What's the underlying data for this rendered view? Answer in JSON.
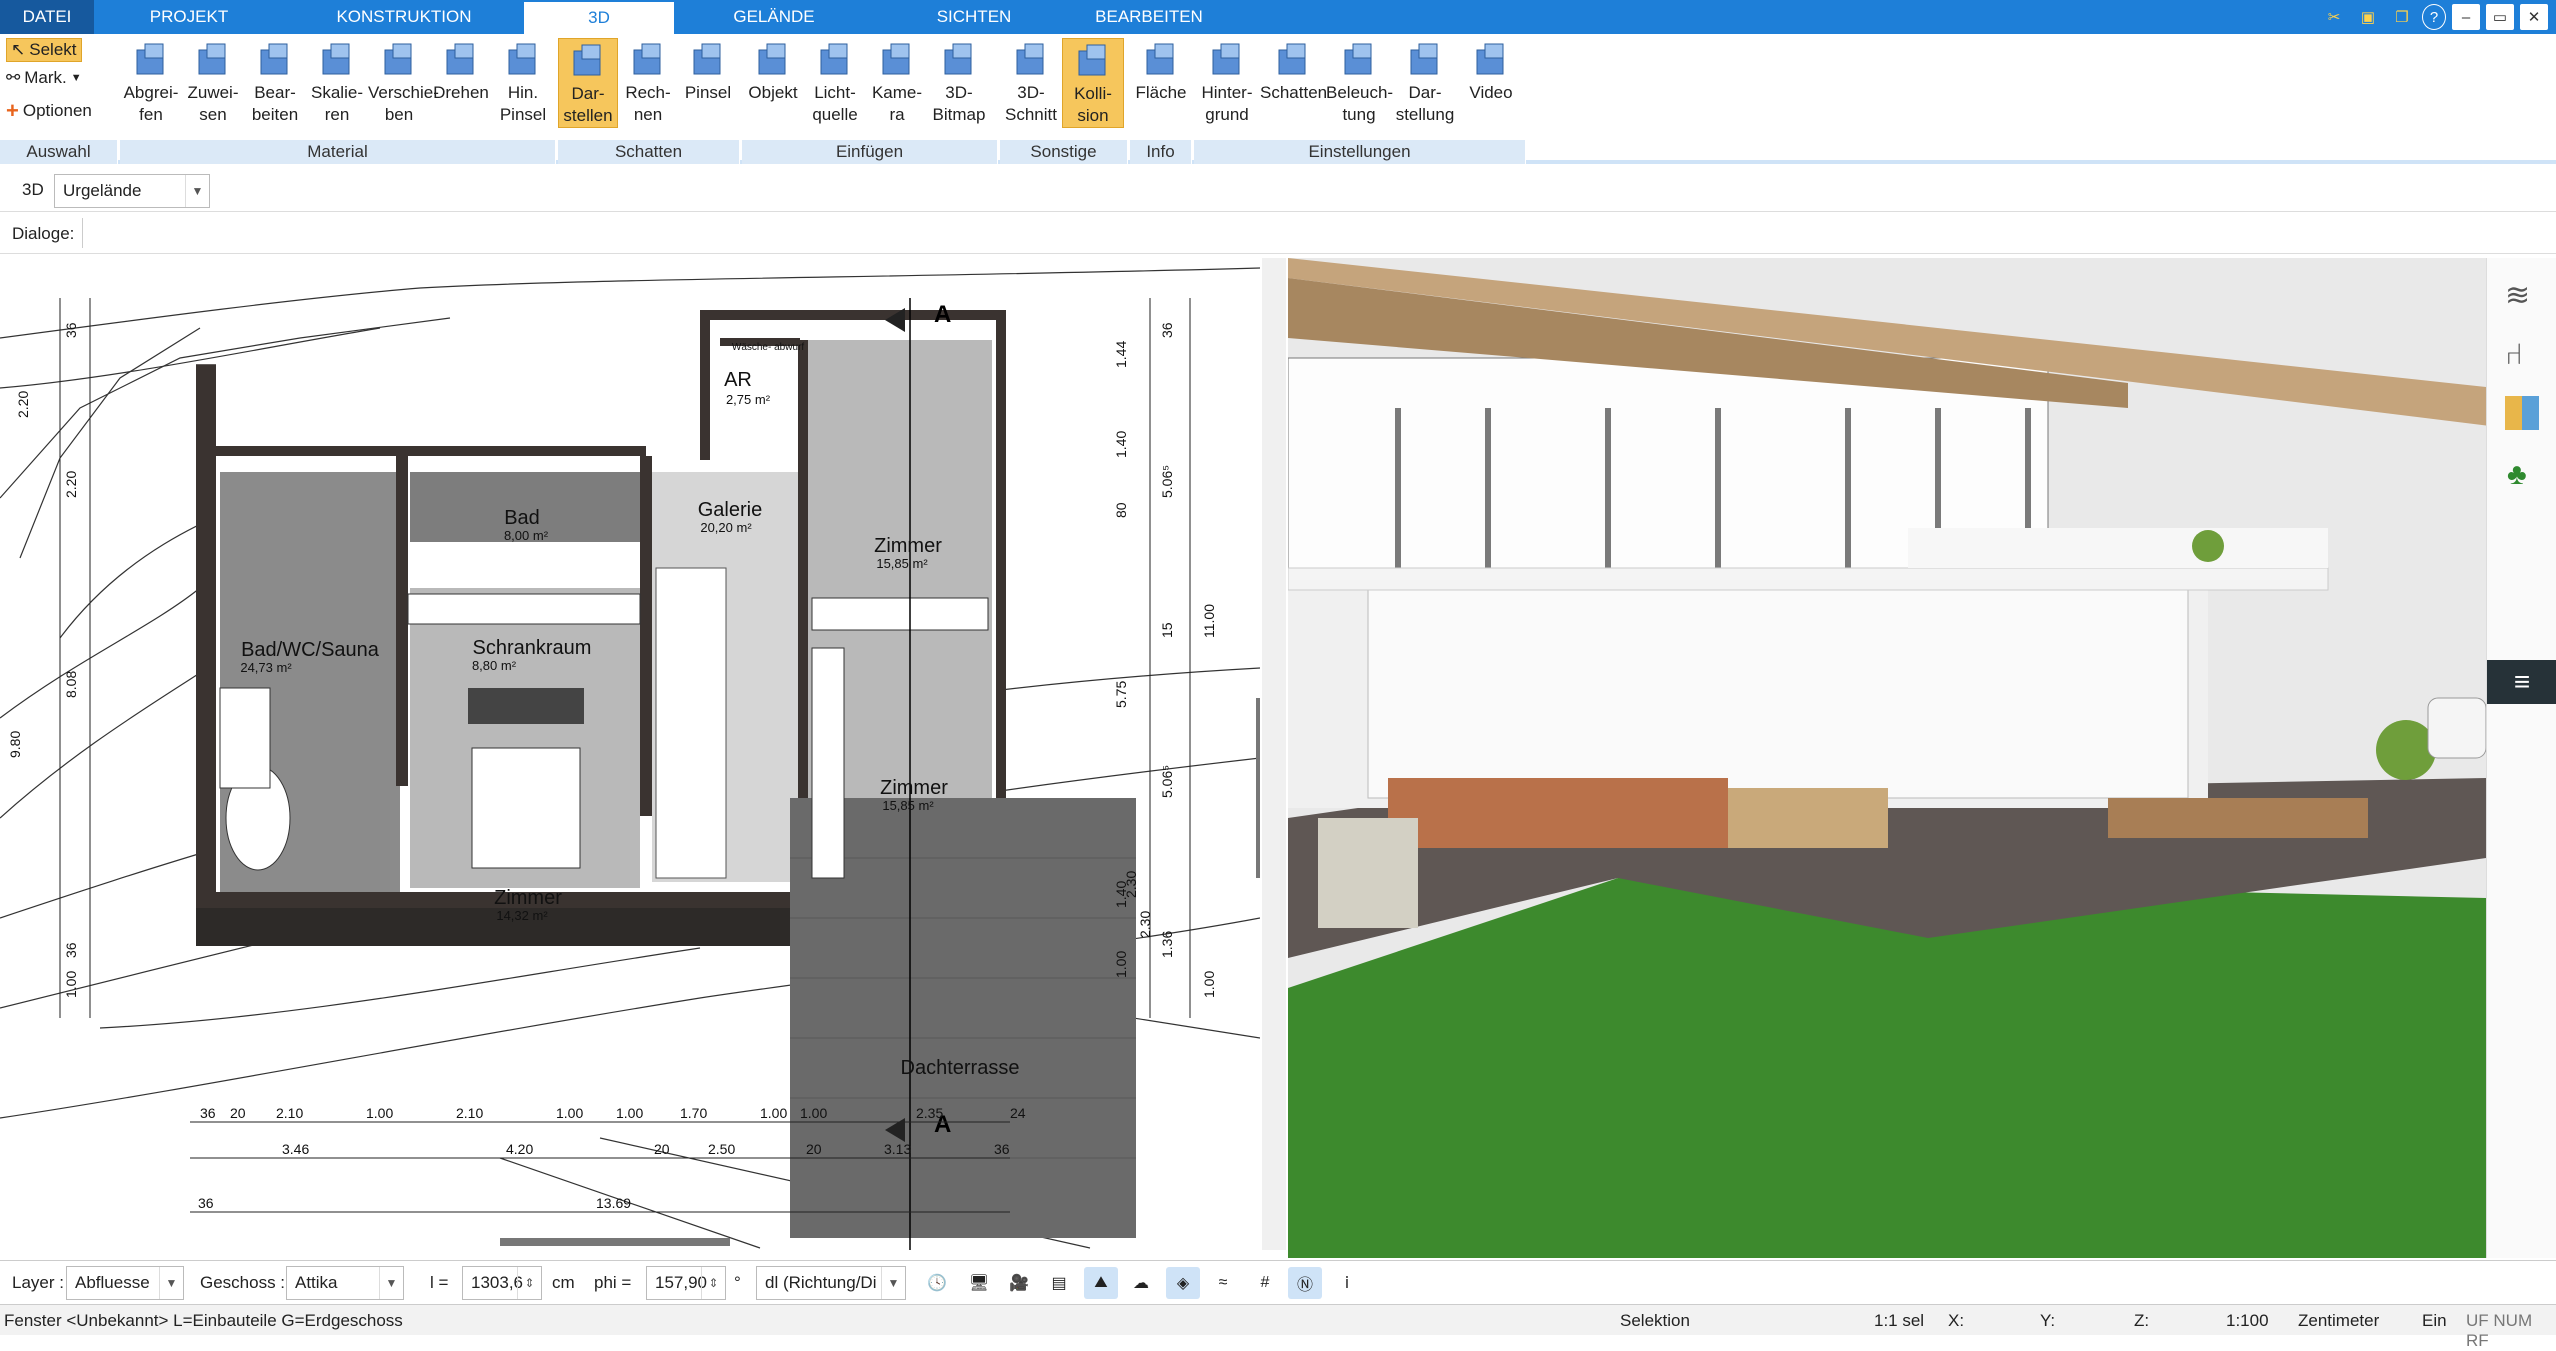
{
  "menu": {
    "file": "DATEI",
    "tabs": [
      "PROJEKT",
      "KONSTRUKTION",
      "3D",
      "GELÄNDE",
      "SICHTEN",
      "BEARBEITEN"
    ],
    "active": "3D"
  },
  "ribbon": {
    "auswahl": {
      "select": "Selekt",
      "mark": "Mark.",
      "options": "Optionen",
      "label": "Auswahl"
    },
    "material": {
      "label": "Material",
      "buttons": [
        "Abgrei-\nfen",
        "Zuwei-\nsen",
        "Bear-\nbeiten",
        "Skalie-\nren",
        "Verschie-\nben",
        "Drehen",
        "Hin.\nPinsel"
      ]
    },
    "schatten": {
      "label": "Schatten",
      "buttons": [
        "Dar-\nstellen",
        "Rech-\nnen",
        "Pinsel"
      ]
    },
    "einfuegen": {
      "label": "Einfügen",
      "buttons": [
        "Objekt",
        "Licht-\nquelle",
        "Kame-\nra",
        "3D-\nBitmap"
      ]
    },
    "sonstige": {
      "label": "Sonstige",
      "buttons": [
        "3D-\nSchnitt",
        "Kolli-\nsion"
      ]
    },
    "info": {
      "label": "Info",
      "buttons": [
        "Fläche"
      ]
    },
    "einstellungen": {
      "label": "Einstellungen",
      "buttons": [
        "Hinter-\ngrund",
        "Schatten",
        "Beleuch-\ntung",
        "Dar-\nstellung",
        "Video"
      ]
    }
  },
  "toolbar": {
    "mode": "3D",
    "terrain": "Urgelände",
    "dialoge": "Dialoge:"
  },
  "plan": {
    "rooms": [
      {
        "name": "AR",
        "area": "2,75 m²"
      },
      {
        "name": "Bad",
        "area": "8,00 m²"
      },
      {
        "name": "Galerie",
        "area": "20,20 m²"
      },
      {
        "name": "Zimmer",
        "area": "15,85 m²"
      },
      {
        "name": "Bad/WC/Sauna",
        "area": "24,73 m²"
      },
      {
        "name": "Schrankraum",
        "area": "8,80 m²"
      },
      {
        "name": "Zimmer",
        "area": "15,85 m²"
      },
      {
        "name": "Zimmer",
        "area": "14,32 m²"
      },
      {
        "name": "Dachterrasse",
        "area": ""
      }
    ],
    "waesche": "Wäsche-\nabwurf",
    "section": "A",
    "dims_bottom1": [
      "36",
      "20",
      "2.10",
      "1.00",
      "2.10",
      "1.00",
      "1.00",
      "1.70",
      "1.00",
      "1.00",
      "2.35",
      "24"
    ],
    "dims_bottom2": [
      "3.46",
      "4.20",
      "20",
      "2.50",
      "20",
      "3.13",
      "36"
    ],
    "dims_bottom3": [
      "36",
      "13.69"
    ],
    "dims_left": [
      "36",
      "2.20",
      "2.20",
      "8.08",
      "9.80",
      "36",
      "1.00"
    ],
    "dims_right": [
      "36",
      "1.44",
      "1.40",
      "80",
      "5.06⁵",
      "15",
      "11.00",
      "5.75",
      "5.06⁵",
      "2.30",
      "1.40",
      "1.00",
      "1.36",
      "1.00",
      "2.30"
    ]
  },
  "bottombar": {
    "layer_label": "Layer :",
    "layer_value": "Abfluesse",
    "geschoss_label": "Geschoss :",
    "geschoss_value": "Attika",
    "l_label": "l =",
    "l_value": "1303,6",
    "l_unit": "cm",
    "phi_label": "phi =",
    "phi_value": "157,90",
    "phi_unit": "°",
    "dl_value": "dl (Richtung/Di"
  },
  "status": {
    "left": "Fenster <Unbekannt> L=Einbauteile G=Erdgeschoss",
    "mode": "Selektion",
    "sel": "1:1 sel",
    "x": "X:",
    "y": "Y:",
    "z": "Z:",
    "scale": "1:100",
    "unit": "Zentimeter",
    "ein": "Ein",
    "flags": "UF NUM RF"
  }
}
